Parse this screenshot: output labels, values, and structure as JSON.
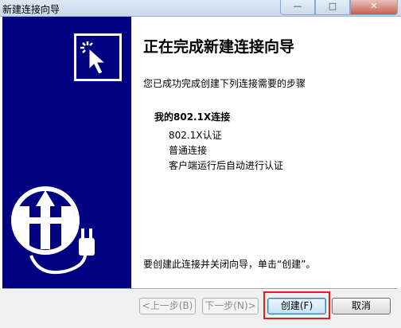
{
  "window": {
    "title": "新建连接向导"
  },
  "content": {
    "heading": "正在完成新建连接向导",
    "intro": "您已成功完成创建下列连接需要的步骤",
    "connection_name": "我的802.1X连接",
    "steps": [
      "802.1X认证",
      "普通连接",
      "客户端运行后自动进行认证"
    ],
    "footer": "要创建此连接并关闭向导，单击“创建”。"
  },
  "buttons": {
    "back": "<上一步(B)",
    "next": "下一步(N)>",
    "create": "创建(F)",
    "cancel": "取消"
  },
  "colors": {
    "panel": "#000080",
    "highlight": "#e0201a"
  },
  "icons": [
    "cursor-click-icon",
    "globe-plug-icon"
  ]
}
